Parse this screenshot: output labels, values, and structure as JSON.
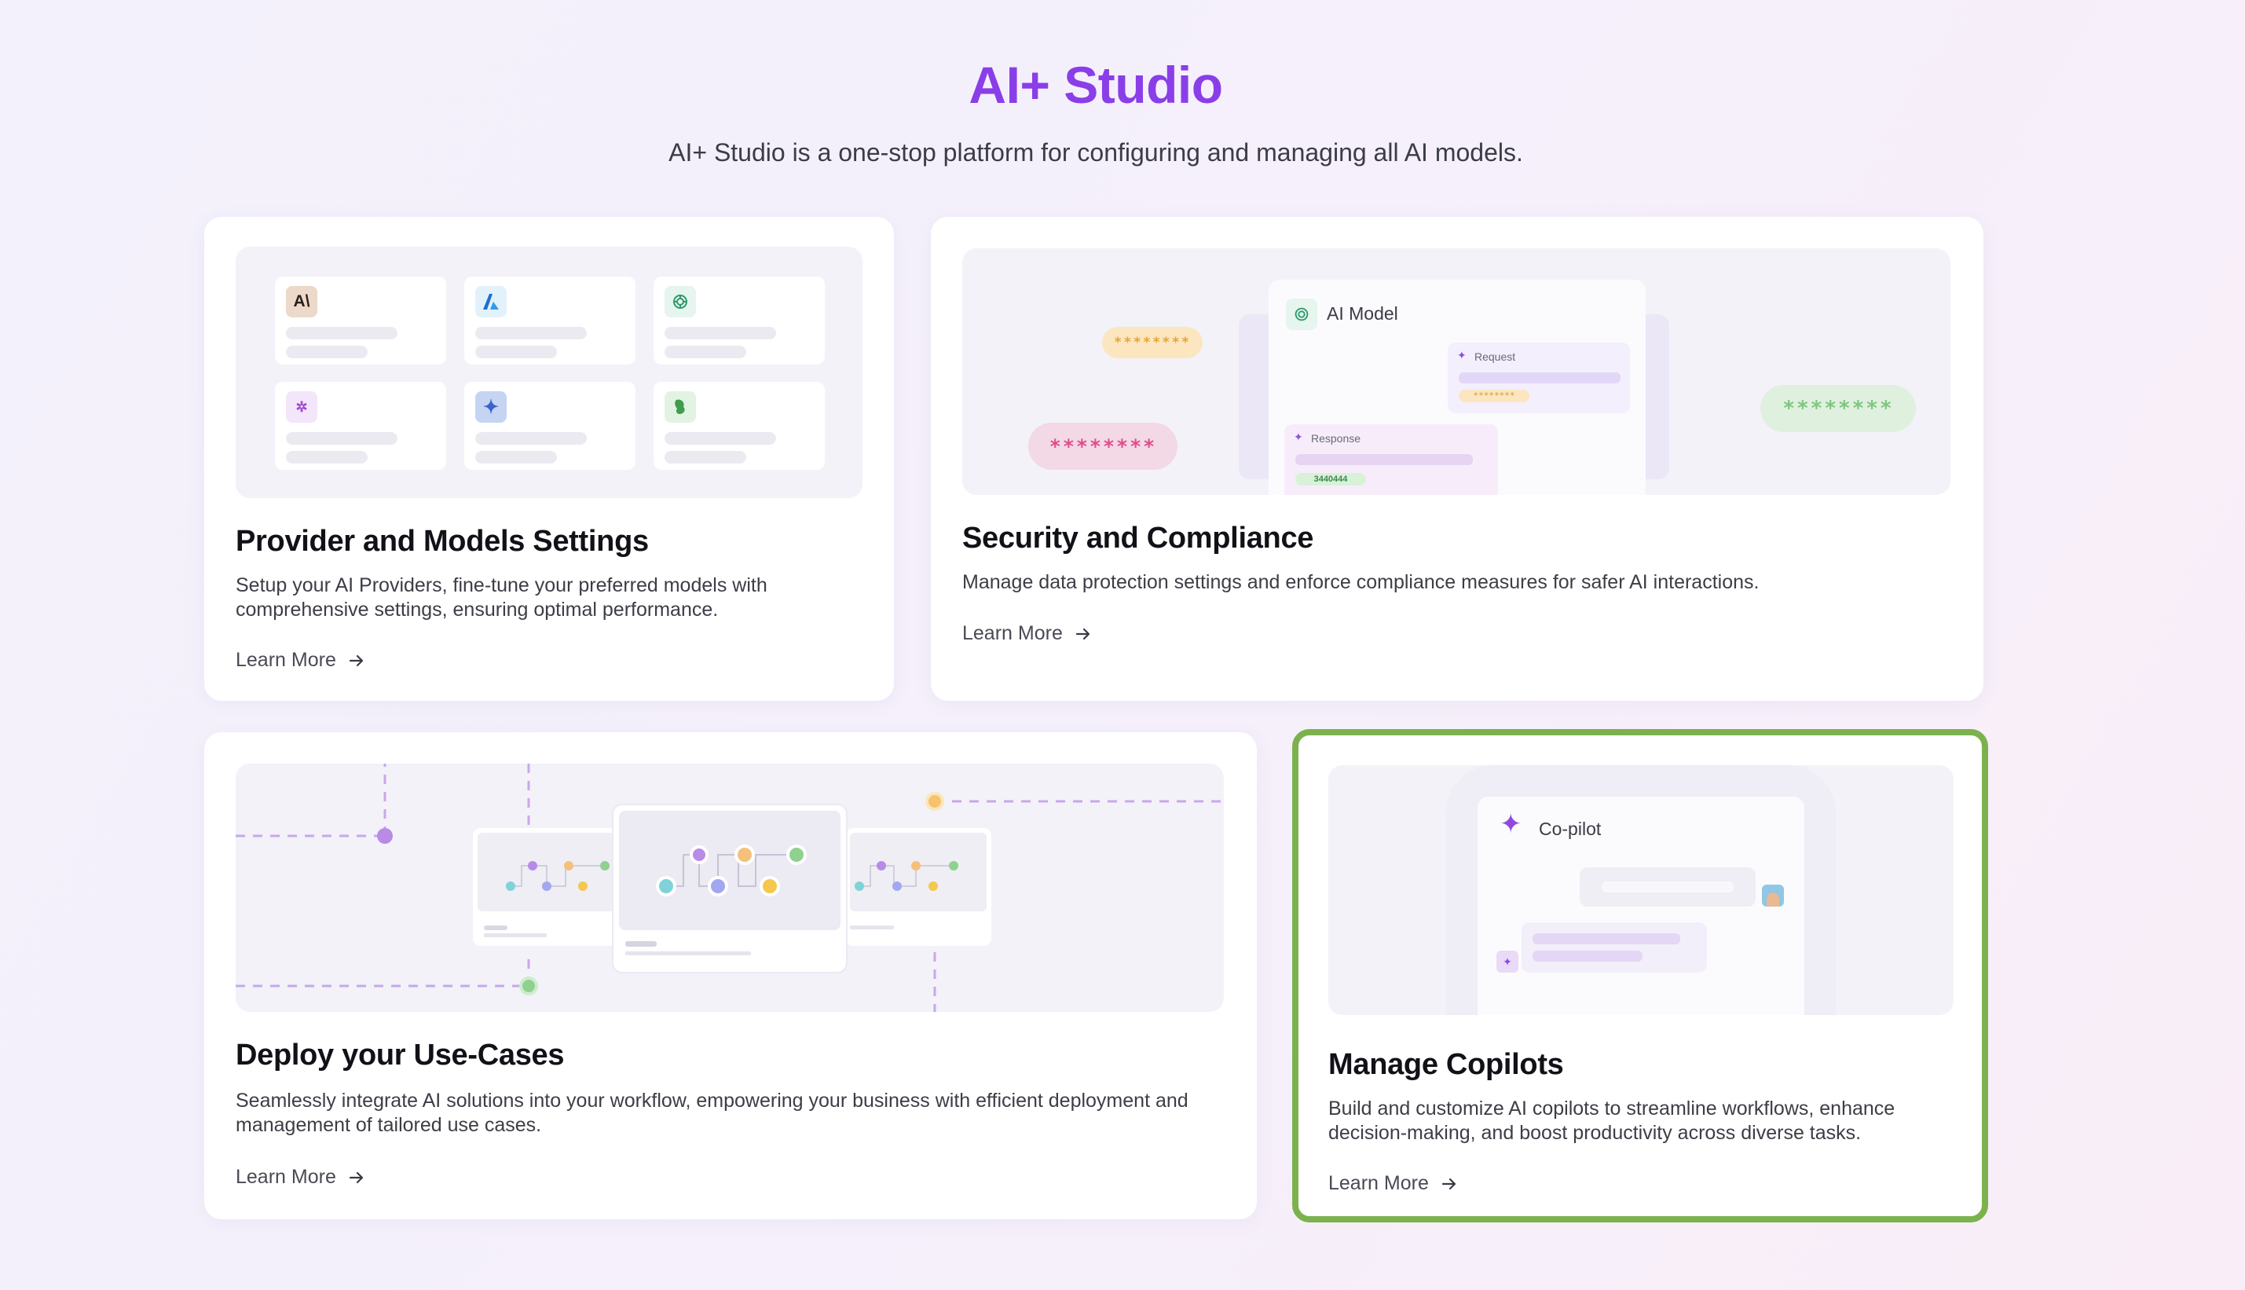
{
  "header": {
    "title": "AI+ Studio",
    "subtitle": "AI+ Studio is a one-stop platform for configuring and managing all AI models."
  },
  "cards": [
    {
      "title": "Provider and Models Settings",
      "description": "Setup your AI Providers, fine-tune your preferred models with comprehensive settings, ensuring optimal performance.",
      "link": "Learn More"
    },
    {
      "title": "Security and Compliance",
      "description": "Manage data protection settings and enforce compliance measures for safer AI interactions.",
      "link": "Learn More"
    },
    {
      "title": "Deploy your Use-Cases",
      "description": "Seamlessly integrate AI solutions into your workflow, empowering your business with efficient deployment and management of tailored use cases.",
      "link": "Learn More"
    },
    {
      "title": "Manage Copilots",
      "description": "Build and customize AI copilots to streamline workflows, enhance decision-making, and boost productivity across diverse tasks.",
      "link": "Learn More"
    }
  ],
  "security_illustration": {
    "panel_title": "AI Model",
    "request_label": "Request",
    "response_label": "Response",
    "response_value": "3440444",
    "masked_orange": "********",
    "masked_pink": "********",
    "masked_green": "********",
    "masked_small": "********"
  },
  "copilot_illustration": {
    "panel_title": "Co-pilot"
  },
  "provider_logos": [
    "anthropic-icon",
    "azure-icon",
    "openai-icon",
    "cohere-icon",
    "gemini-icon",
    "llama-icon"
  ],
  "colors": {
    "title": "#8a3ee8",
    "highlight_border": "#7cb24e",
    "card_bg": "#ffffff",
    "page_bg": "#f4f1fb"
  }
}
